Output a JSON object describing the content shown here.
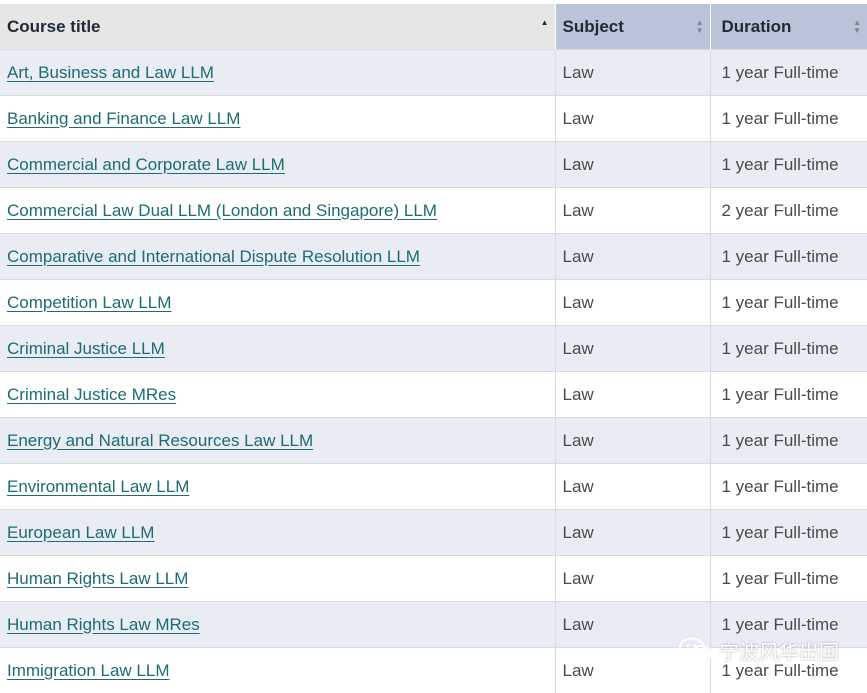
{
  "table": {
    "headers": {
      "title": "Course title",
      "subject": "Subject",
      "duration": "Duration"
    },
    "rows": [
      {
        "title": "Art, Business and Law LLM",
        "subject": "Law",
        "duration": "1 year Full-time"
      },
      {
        "title": "Banking and Finance Law LLM",
        "subject": "Law",
        "duration": "1 year Full-time"
      },
      {
        "title": "Commercial and Corporate Law LLM",
        "subject": "Law",
        "duration": "1 year Full-time"
      },
      {
        "title": "Commercial Law Dual LLM (London and Singapore) LLM",
        "subject": "Law",
        "duration": "2 year Full-time"
      },
      {
        "title": "Comparative and International Dispute Resolution LLM",
        "subject": "Law",
        "duration": "1 year Full-time"
      },
      {
        "title": "Competition Law LLM",
        "subject": "Law",
        "duration": "1 year Full-time"
      },
      {
        "title": "Criminal Justice LLM",
        "subject": "Law",
        "duration": "1 year Full-time"
      },
      {
        "title": "Criminal Justice MRes",
        "subject": "Law",
        "duration": "1 year Full-time"
      },
      {
        "title": "Energy and Natural Resources Law LLM",
        "subject": "Law",
        "duration": "1 year Full-time"
      },
      {
        "title": "Environmental Law LLM",
        "subject": "Law",
        "duration": "1 year Full-time"
      },
      {
        "title": "European Law LLM",
        "subject": "Law",
        "duration": "1 year Full-time"
      },
      {
        "title": "Human Rights Law LLM",
        "subject": "Law",
        "duration": "1 year Full-time"
      },
      {
        "title": "Human Rights Law MRes",
        "subject": "Law",
        "duration": "1 year Full-time"
      },
      {
        "title": "Immigration Law LLM",
        "subject": "Law",
        "duration": "1 year Full-time"
      }
    ]
  },
  "watermark": {
    "text": "宁波风华出国",
    "icon": "wechat-icon"
  },
  "colors": {
    "header_title_bg": "#e6e6e6",
    "header_sorted_bg": "#b9c4d8",
    "row_alt_bg": "#e9ecf2",
    "link": "#1d6b73"
  }
}
